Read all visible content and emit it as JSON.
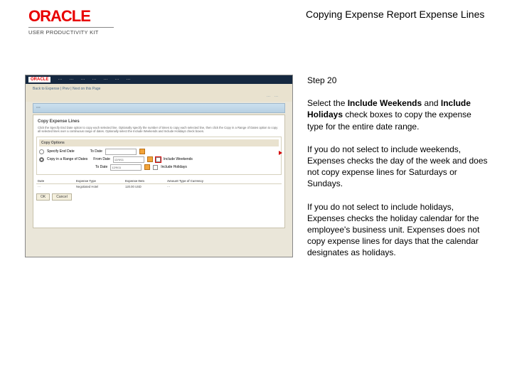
{
  "header": {
    "brand": "ORACLE",
    "subline": "USER PRODUCTIVITY KIT",
    "title": "Copying Expense Report Expense Lines"
  },
  "right": {
    "step": "Step 20",
    "p1a": "Select the ",
    "p1b": "Include Weekends",
    "p1c": " and ",
    "p1d": "Include Holidays",
    "p1e": " check boxes to copy the expense type for the entire date range.",
    "p2": "If you do not select to include weekends, Expenses checks the day of the week and does not copy expense lines for Saturdays or Sundays.",
    "p3": "If you do not select to include holidays, Expenses checks the holiday calendar for the employee's business unit. Expenses does not copy expense lines for days that the calendar designates as holidays."
  },
  "shot": {
    "brand": "ORACLE",
    "breadcrumb": "Back to Expense | Prev | Next on this Page",
    "modal_title": "Copy Expense Lines",
    "modal_desc": "Click the Specify End Date option to copy each selected line. Optionally specify the number of times to copy each selected line, then click the Copy in a Range of Dates option to copy all selected lines over a continuous range of dates. Optionally select the Include Weekends and Include Holidays check boxes.",
    "opts_title": "Copy Options",
    "opt_specify": "Specify End Date",
    "to_date_lbl": "To Date",
    "opt_range": "Copy in a Range of Dates",
    "from_date_lbl": "From Date",
    "from_date_val": "12/9/11",
    "to_date_val": "12/9/11",
    "chk_weekends": "Include Weekends",
    "chk_holidays": "Include Holidays",
    "th1": "Date",
    "th2": "Expense Type",
    "th3": "Expense Item",
    "th4": "Amount Type of Currency",
    "td2": "Negotiated Hotel",
    "td3": "120.00 USD",
    "btn_ok": "OK",
    "btn_cancel": "Cancel"
  }
}
